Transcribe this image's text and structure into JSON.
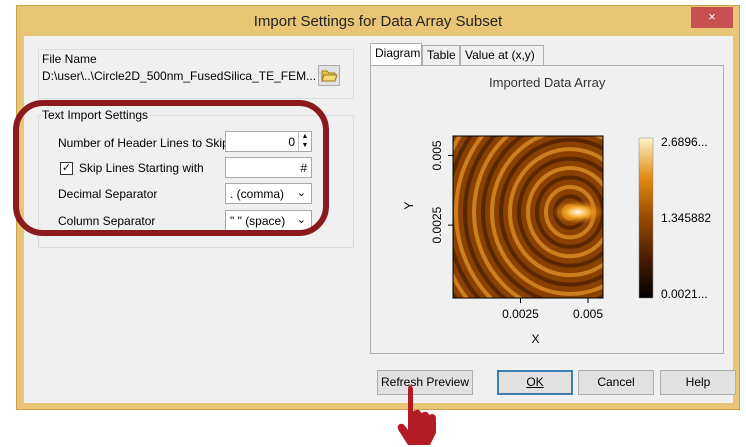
{
  "dialog": {
    "title": "Import Settings for Data Array Subset",
    "close_glyph": "×"
  },
  "file": {
    "group_label": "File Name",
    "path": "D:\\user\\..\\Circle2D_500nm_FusedSilica_TE_FEM..."
  },
  "text_import": {
    "group_label": "Text Import Settings",
    "header_lines_label": "Number of Header Lines to Skip",
    "header_lines_value": "0",
    "skip_lines_label": "Skip Lines Starting with",
    "skip_lines_checked": true,
    "skip_lines_value": "#",
    "decimal_label": "Decimal Separator",
    "decimal_value": ". (comma)",
    "column_label": "Column Separator",
    "column_value": "\" \" (space)"
  },
  "tabs": [
    "Diagram",
    "Table",
    "Value at (x,y)"
  ],
  "chart_data": {
    "type": "heatmap",
    "title": "Imported Data Array",
    "xlabel": "X",
    "ylabel": "Y",
    "x_ticks": [
      "0.0025",
      "0.005"
    ],
    "y_ticks": [
      "0.0025",
      "0.005"
    ],
    "colorbar_labels": [
      "2.6896...",
      "1.345882",
      "0.0021..."
    ],
    "colormap": [
      "#000000",
      "#4a1d00",
      "#9a4a00",
      "#e08a10",
      "#fff2c8"
    ]
  },
  "buttons": {
    "refresh": "Refresh Preview",
    "ok": "OK",
    "cancel": "Cancel",
    "help": "Help"
  },
  "colors": {
    "title_bar": "#e9c676",
    "highlight": "#8b1a1f",
    "hand": "#b31b24"
  }
}
